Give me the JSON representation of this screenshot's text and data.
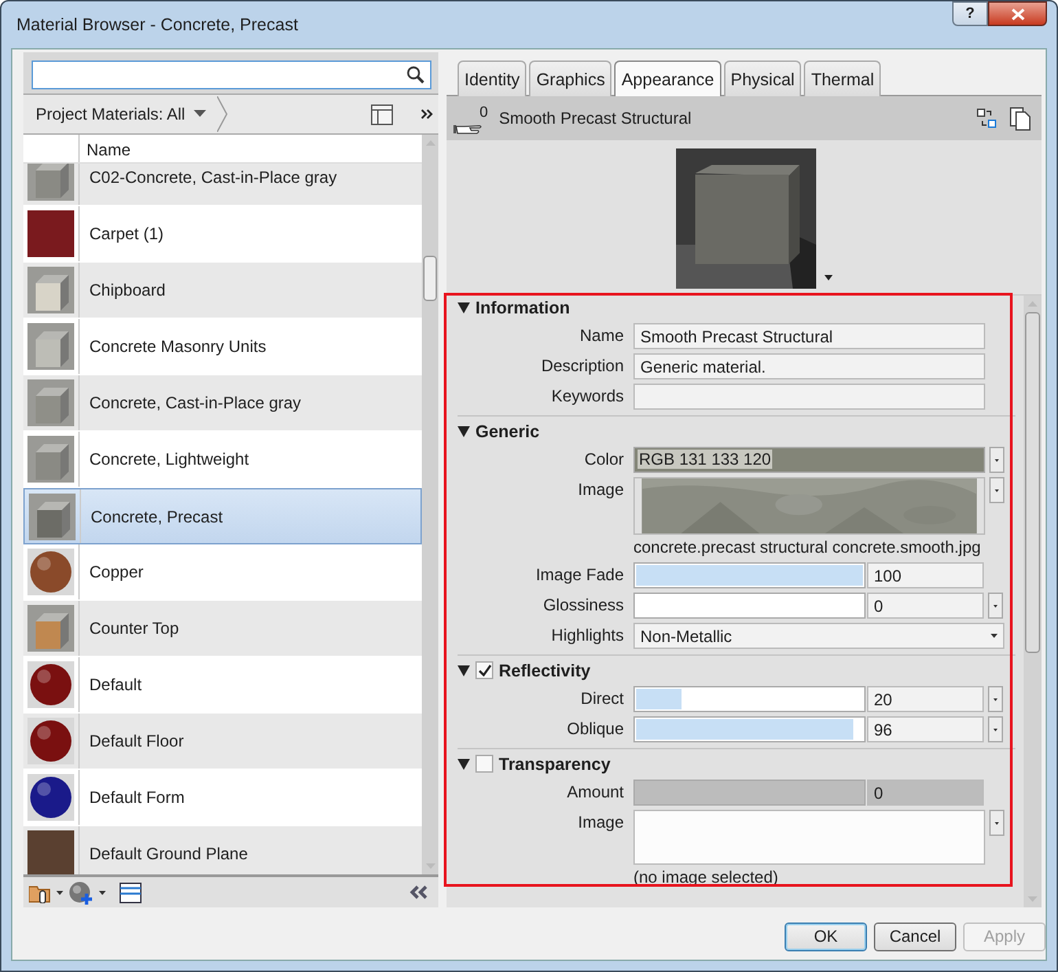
{
  "window": {
    "title": "Material Browser - Concrete, Precast",
    "help_button": "?"
  },
  "library": {
    "filter": "Project Materials: All",
    "column": "Name",
    "materials": [
      {
        "name": "C02-Concrete, Cast-in-Place gray",
        "kind": "cube",
        "color": "#8a8a84",
        "selected": false
      },
      {
        "name": "Carpet (1)",
        "kind": "swatch",
        "color": "#7a1a1e",
        "selected": false
      },
      {
        "name": "Chipboard",
        "kind": "cube",
        "color": "#d8d4c8",
        "selected": false
      },
      {
        "name": "Concrete Masonry Units",
        "kind": "cube",
        "color": "#bdbdb6",
        "selected": false
      },
      {
        "name": "Concrete, Cast-in-Place gray",
        "kind": "cube",
        "color": "#8f8f88",
        "selected": false
      },
      {
        "name": "Concrete, Lightweight",
        "kind": "cube",
        "color": "#8a8a84",
        "selected": false
      },
      {
        "name": "Concrete, Precast",
        "kind": "cube",
        "color": "#6c6c66",
        "selected": true
      },
      {
        "name": "Copper",
        "kind": "sphere",
        "color": "#8a4a2a",
        "selected": false
      },
      {
        "name": "Counter Top",
        "kind": "cube",
        "color": "#c08850",
        "selected": false
      },
      {
        "name": "Default",
        "kind": "sphere",
        "color": "#7a1010",
        "selected": false
      },
      {
        "name": "Default Floor",
        "kind": "sphere",
        "color": "#7a1010",
        "selected": false
      },
      {
        "name": "Default Form",
        "kind": "sphere",
        "color": "#1a1a8a",
        "selected": false
      },
      {
        "name": "Default Ground Plane",
        "kind": "swatch",
        "color": "#5a4030",
        "selected": false
      }
    ]
  },
  "tabs": [
    {
      "label": "Identity",
      "selected": false
    },
    {
      "label": "Graphics",
      "selected": false
    },
    {
      "label": "Appearance",
      "selected": true
    },
    {
      "label": "Physical",
      "selected": false
    },
    {
      "label": "Thermal",
      "selected": false
    }
  ],
  "asset": {
    "usage_count": "0",
    "name": "Smooth Precast Structural"
  },
  "sections": [
    {
      "title": "Information",
      "expanded": true,
      "rows": [
        {
          "kind": "text",
          "label": "Name",
          "value": "Smooth Precast Structural"
        },
        {
          "kind": "text",
          "label": "Description",
          "value": "Generic material."
        },
        {
          "kind": "text",
          "label": "Keywords"
        }
      ]
    },
    {
      "title": "Generic",
      "expanded": true,
      "rows": [
        {
          "kind": "color",
          "label": "Color",
          "value": "RGB 131 133 120",
          "color": "#838578"
        },
        {
          "label": "Image",
          "caption": "concrete.precast structural concrete.smooth.jpg"
        },
        {
          "kind": "slider",
          "label": "Image Fade",
          "level": 1,
          "value": "100",
          "menu": false
        },
        {
          "kind": "slider",
          "label": "Glossiness",
          "level": 0,
          "value": "0",
          "menu": true
        },
        {
          "kind": "dropdown",
          "label": "Highlights",
          "value": "Non-Metallic"
        }
      ]
    },
    {
      "title": "Reflectivity",
      "expanded": true,
      "checked": true,
      "rows": [
        {
          "kind": "slider",
          "label": "Direct",
          "level": 0.2,
          "value": "20",
          "menu": true
        },
        {
          "kind": "slider",
          "label": "Oblique",
          "level": 0.96,
          "value": "96",
          "menu": true
        }
      ]
    },
    {
      "title": "Transparency",
      "expanded": true,
      "checked": false,
      "rows": [
        {
          "kind": "slider",
          "label": "Amount",
          "level": 0,
          "value": "0",
          "menu": false,
          "disabled": true
        },
        {
          "label": "Image",
          "caption": "(no image selected)",
          "empty": true
        }
      ]
    }
  ],
  "buttons": [
    {
      "label": "OK",
      "default": true,
      "disabled": false
    },
    {
      "label": "Cancel",
      "default": false,
      "disabled": false
    },
    {
      "label": "Apply",
      "default": false,
      "disabled": true
    }
  ]
}
